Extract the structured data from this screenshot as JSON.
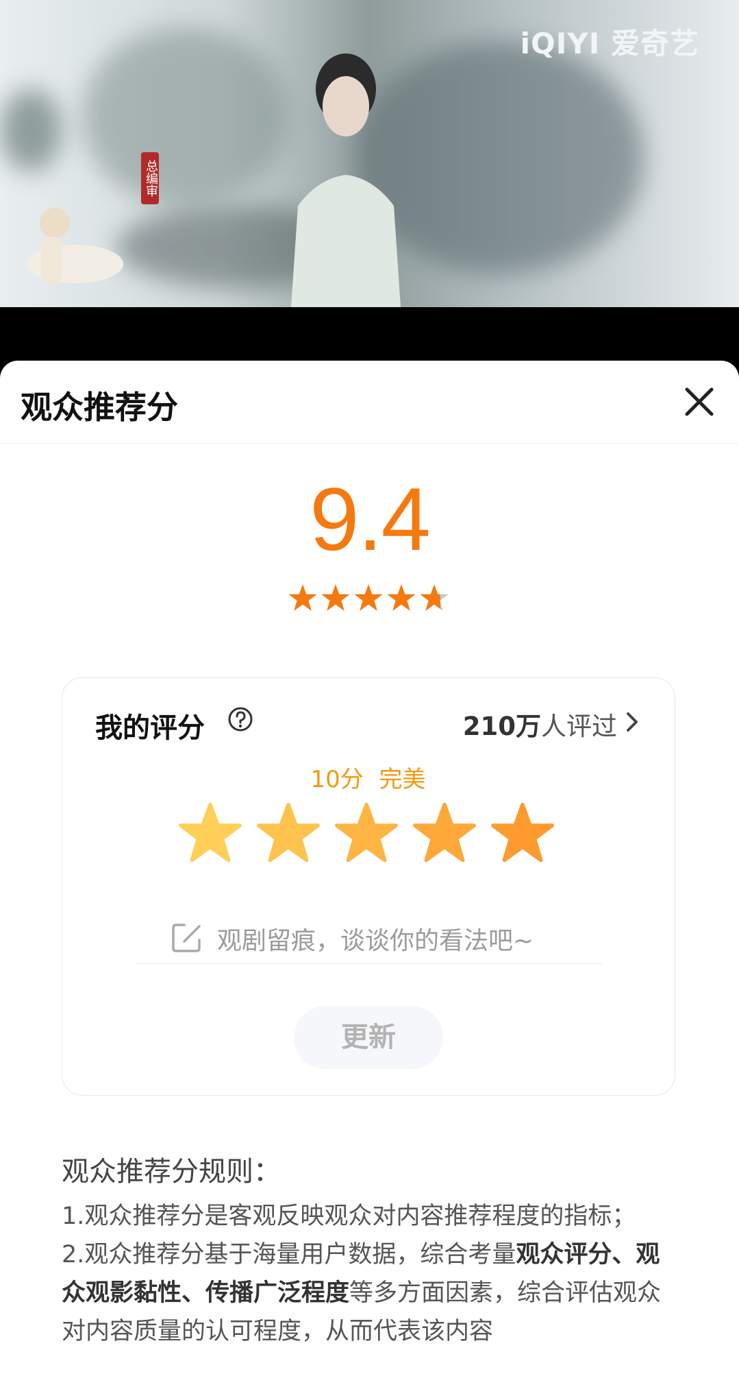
{
  "video": {
    "logo": "iQIYI 爱奇艺",
    "seal_text": "总编审"
  },
  "sheet": {
    "title": "观众推荐分",
    "score": "9.4",
    "star_rating": 4.7,
    "card": {
      "my_score_label": "我的评分",
      "rater_count_number": "210万",
      "rater_count_suffix": "人评过",
      "rating_value": "10分",
      "rating_desc": "完美",
      "selected_stars": 5,
      "comment_placeholder": "观剧留痕，谈谈你的看法吧~",
      "update_label": "更新"
    },
    "rules": {
      "title": "观众推荐分规则：",
      "item1": "1.观众推荐分是客观反映观众对内容推荐程度的指标；",
      "item2_prefix": "2.观众推荐分基于海量用户数据，综合考量",
      "item2_bold": "观众评分、观众观影黏性、传播广泛程度",
      "item2_suffix": "等多方面因素，综合评估观众对内容质量的认可程度，从而代表该内容"
    }
  },
  "colors": {
    "accent": "#f5790f",
    "star_light": "#ffcf57",
    "star_dark": "#ff9a2e"
  }
}
